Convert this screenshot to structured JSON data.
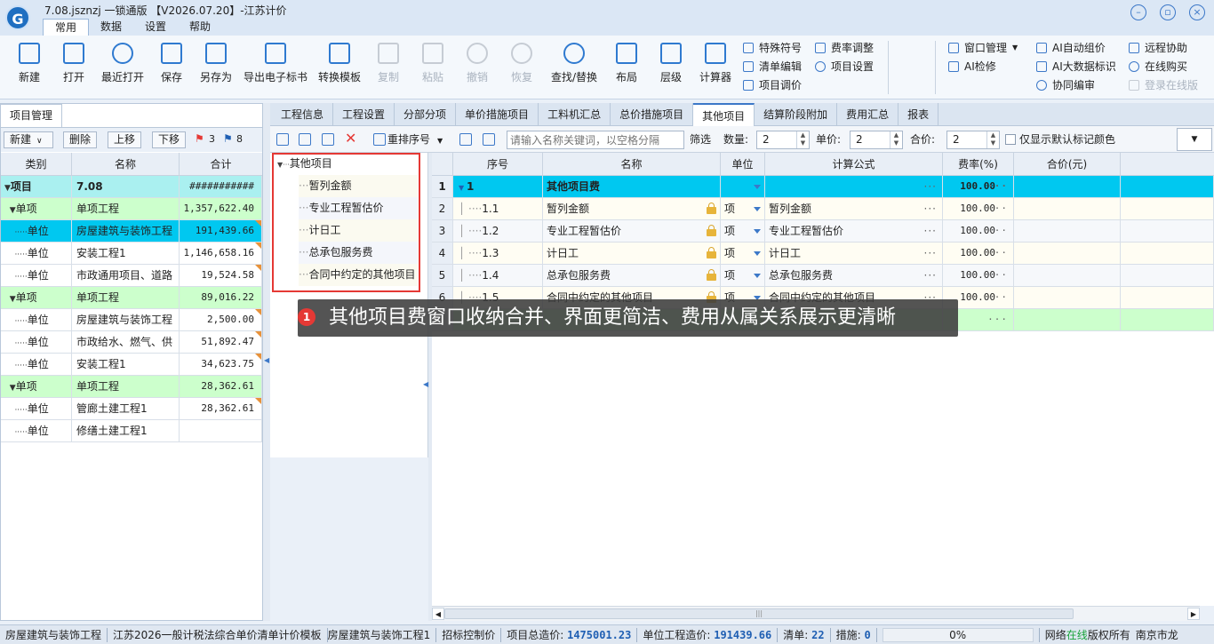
{
  "app": {
    "title": "7.08.jsznzj 一锁通版 【V2026.07.20】-江苏计价",
    "logo": "G",
    "menu_tabs": [
      "常用",
      "数据",
      "设置",
      "帮助"
    ],
    "active_menu": "常用"
  },
  "ribbon": {
    "buttons": [
      {
        "label": "新建",
        "icon": "new-file-icon",
        "enabled": true
      },
      {
        "label": "打开",
        "icon": "open-folder-icon",
        "enabled": true
      },
      {
        "label": "最近打开",
        "icon": "recent-icon",
        "enabled": true
      },
      {
        "label": "保存",
        "icon": "save-icon",
        "enabled": true
      },
      {
        "label": "另存为",
        "icon": "save-as-icon",
        "enabled": true
      },
      {
        "label": "导出电子标书",
        "icon": "export-icon",
        "enabled": true
      },
      {
        "label": "转换模板",
        "icon": "convert-icon",
        "enabled": true
      },
      {
        "label": "复制",
        "icon": "copy-icon",
        "enabled": false
      },
      {
        "label": "粘贴",
        "icon": "paste-icon",
        "enabled": false
      },
      {
        "label": "撤销",
        "icon": "undo-icon",
        "enabled": false
      },
      {
        "label": "恢复",
        "icon": "redo-icon",
        "enabled": false
      },
      {
        "label": "查找/替换",
        "icon": "search-icon",
        "enabled": true
      },
      {
        "label": "布局",
        "icon": "layout-icon",
        "enabled": true
      },
      {
        "label": "层级",
        "icon": "hierarchy-icon",
        "enabled": true
      },
      {
        "label": "计算器",
        "icon": "calculator-icon",
        "enabled": true
      }
    ],
    "small_items_a": [
      "特殊符号",
      "清单编辑",
      "项目调价"
    ],
    "small_items_b": [
      "费率调整",
      "项目设置"
    ],
    "small_items_c": [
      "窗口管理",
      "AI检修"
    ],
    "small_items_d": [
      "AI自动组价",
      "AI大数据标识",
      "协同编审"
    ],
    "small_items_e": [
      "远程协助",
      "在线购买",
      "登录在线版"
    ]
  },
  "left_panel": {
    "tab": "项目管理",
    "toolbar": {
      "new": "新建",
      "delete": "删除",
      "up": "上移",
      "down": "下移",
      "red_flag_count": "3",
      "blue_flag_count": "8"
    },
    "headers": [
      "类别",
      "名称",
      "合计"
    ],
    "rows": [
      {
        "type": "项目",
        "name": "7.08",
        "total": "###########",
        "level": 0,
        "style": "project"
      },
      {
        "type": "单项",
        "name": "单项工程",
        "total": "1,357,622.40",
        "level": 1,
        "style": "group"
      },
      {
        "type": "单位",
        "name": "房屋建筑与装饰工程",
        "total": "191,439.66",
        "level": 2,
        "style": "selected",
        "flag": true
      },
      {
        "type": "单位",
        "name": "安装工程1",
        "total": "1,146,658.16",
        "level": 2,
        "style": "",
        "flag": true
      },
      {
        "type": "单位",
        "name": "市政通用项目、道路",
        "total": "19,524.58",
        "level": 2,
        "style": "",
        "flag": true
      },
      {
        "type": "单项",
        "name": "单项工程",
        "total": "89,016.22",
        "level": 1,
        "style": "group"
      },
      {
        "type": "单位",
        "name": "房屋建筑与装饰工程",
        "total": "2,500.00",
        "level": 2,
        "style": "",
        "flag": true
      },
      {
        "type": "单位",
        "name": "市政给水、燃气、供",
        "total": "51,892.47",
        "level": 2,
        "style": "",
        "flag": true
      },
      {
        "type": "单位",
        "name": "安装工程1",
        "total": "34,623.75",
        "level": 2,
        "style": "",
        "flag": true
      },
      {
        "type": "单项",
        "name": "单项工程",
        "total": "28,362.61",
        "level": 1,
        "style": "group"
      },
      {
        "type": "单位",
        "name": "管廊土建工程1",
        "total": "28,362.61",
        "level": 2,
        "style": "",
        "flag": true
      },
      {
        "type": "单位",
        "name": "修缮土建工程1",
        "total": "",
        "level": 2,
        "style": ""
      }
    ]
  },
  "right_tabs": [
    "工程信息",
    "工程设置",
    "分部分项",
    "单价措施项目",
    "工料机汇总",
    "总价措施项目",
    "其他项目",
    "结算阶段附加",
    "费用汇总",
    "报表"
  ],
  "active_right_tab": "其他项目",
  "toolbar": {
    "renumber": "重排序号",
    "search_placeholder": "请输入名称关键词，以空格分隔",
    "filter": "筛选",
    "qty_label": "数量:",
    "qty_value": "2",
    "price_label": "单价:",
    "price_value": "2",
    "total_label": "合价:",
    "total_value": "2",
    "default_color_label": "仅显示默认标记颜色"
  },
  "tree": {
    "root": "其他项目",
    "children": [
      "暂列金额",
      "专业工程暂估价",
      "计日工",
      "总承包服务费",
      "合同中约定的其他项目"
    ]
  },
  "grid": {
    "headers": [
      "",
      "序号",
      "名称",
      "单位",
      "计算公式",
      "费率(%)",
      "合价(元)",
      ""
    ],
    "rows": [
      {
        "idx": "1",
        "seq": "1",
        "name": "其他项目费",
        "unit": "",
        "formula": "",
        "rate": "100.00",
        "style": "top"
      },
      {
        "idx": "2",
        "seq": "1.1",
        "name": "暂列金额",
        "unit": "项",
        "formula": "暂列金额",
        "rate": "100.00",
        "style": "sub"
      },
      {
        "idx": "3",
        "seq": "1.2",
        "name": "专业工程暂估价",
        "unit": "项",
        "formula": "专业工程暂估价",
        "rate": "100.00",
        "style": "sub"
      },
      {
        "idx": "4",
        "seq": "1.3",
        "name": "计日工",
        "unit": "项",
        "formula": "计日工",
        "rate": "100.00",
        "style": "sub"
      },
      {
        "idx": "5",
        "seq": "1.4",
        "name": "总承包服务费",
        "unit": "项",
        "formula": "总承包服务费",
        "rate": "100.00",
        "style": "sub"
      },
      {
        "idx": "6",
        "seq": "1.5",
        "name": "合同中约定的其他项目",
        "unit": "项",
        "formula": "合同中约定的其他项目",
        "rate": "100.00",
        "style": "sub"
      },
      {
        "idx": "",
        "seq": "",
        "name": "",
        "unit": "",
        "formula": "",
        "rate": "",
        "style": "green"
      }
    ]
  },
  "callout": {
    "number": "1",
    "text": "其他项目费窗口收纳合并、界面更简洁、费用从属关系展示更清晰"
  },
  "status": {
    "items": [
      "房屋建筑与装饰工程",
      "江苏2026一般计税法综合单价清单计价模板",
      "房屋建筑与装饰工程1",
      "招标控制价"
    ],
    "project_total_label": "项目总造价:",
    "project_total": "1475001.23",
    "unit_total_label": "单位工程造价:",
    "unit_total": "191439.66",
    "list_label": "清单:",
    "list_count": "22",
    "measure_label": "措施:",
    "measure_count": "0",
    "progress": "0%",
    "network_prefix": "网络",
    "network_status": "在线",
    "copyright": "版权所有",
    "company": "南京市龙"
  },
  "colors": {
    "accent": "#3c78c8",
    "selected": "#00c8f0",
    "group": "#ccffcc",
    "project": "#aaf0f0",
    "highlight": "#e53935"
  }
}
